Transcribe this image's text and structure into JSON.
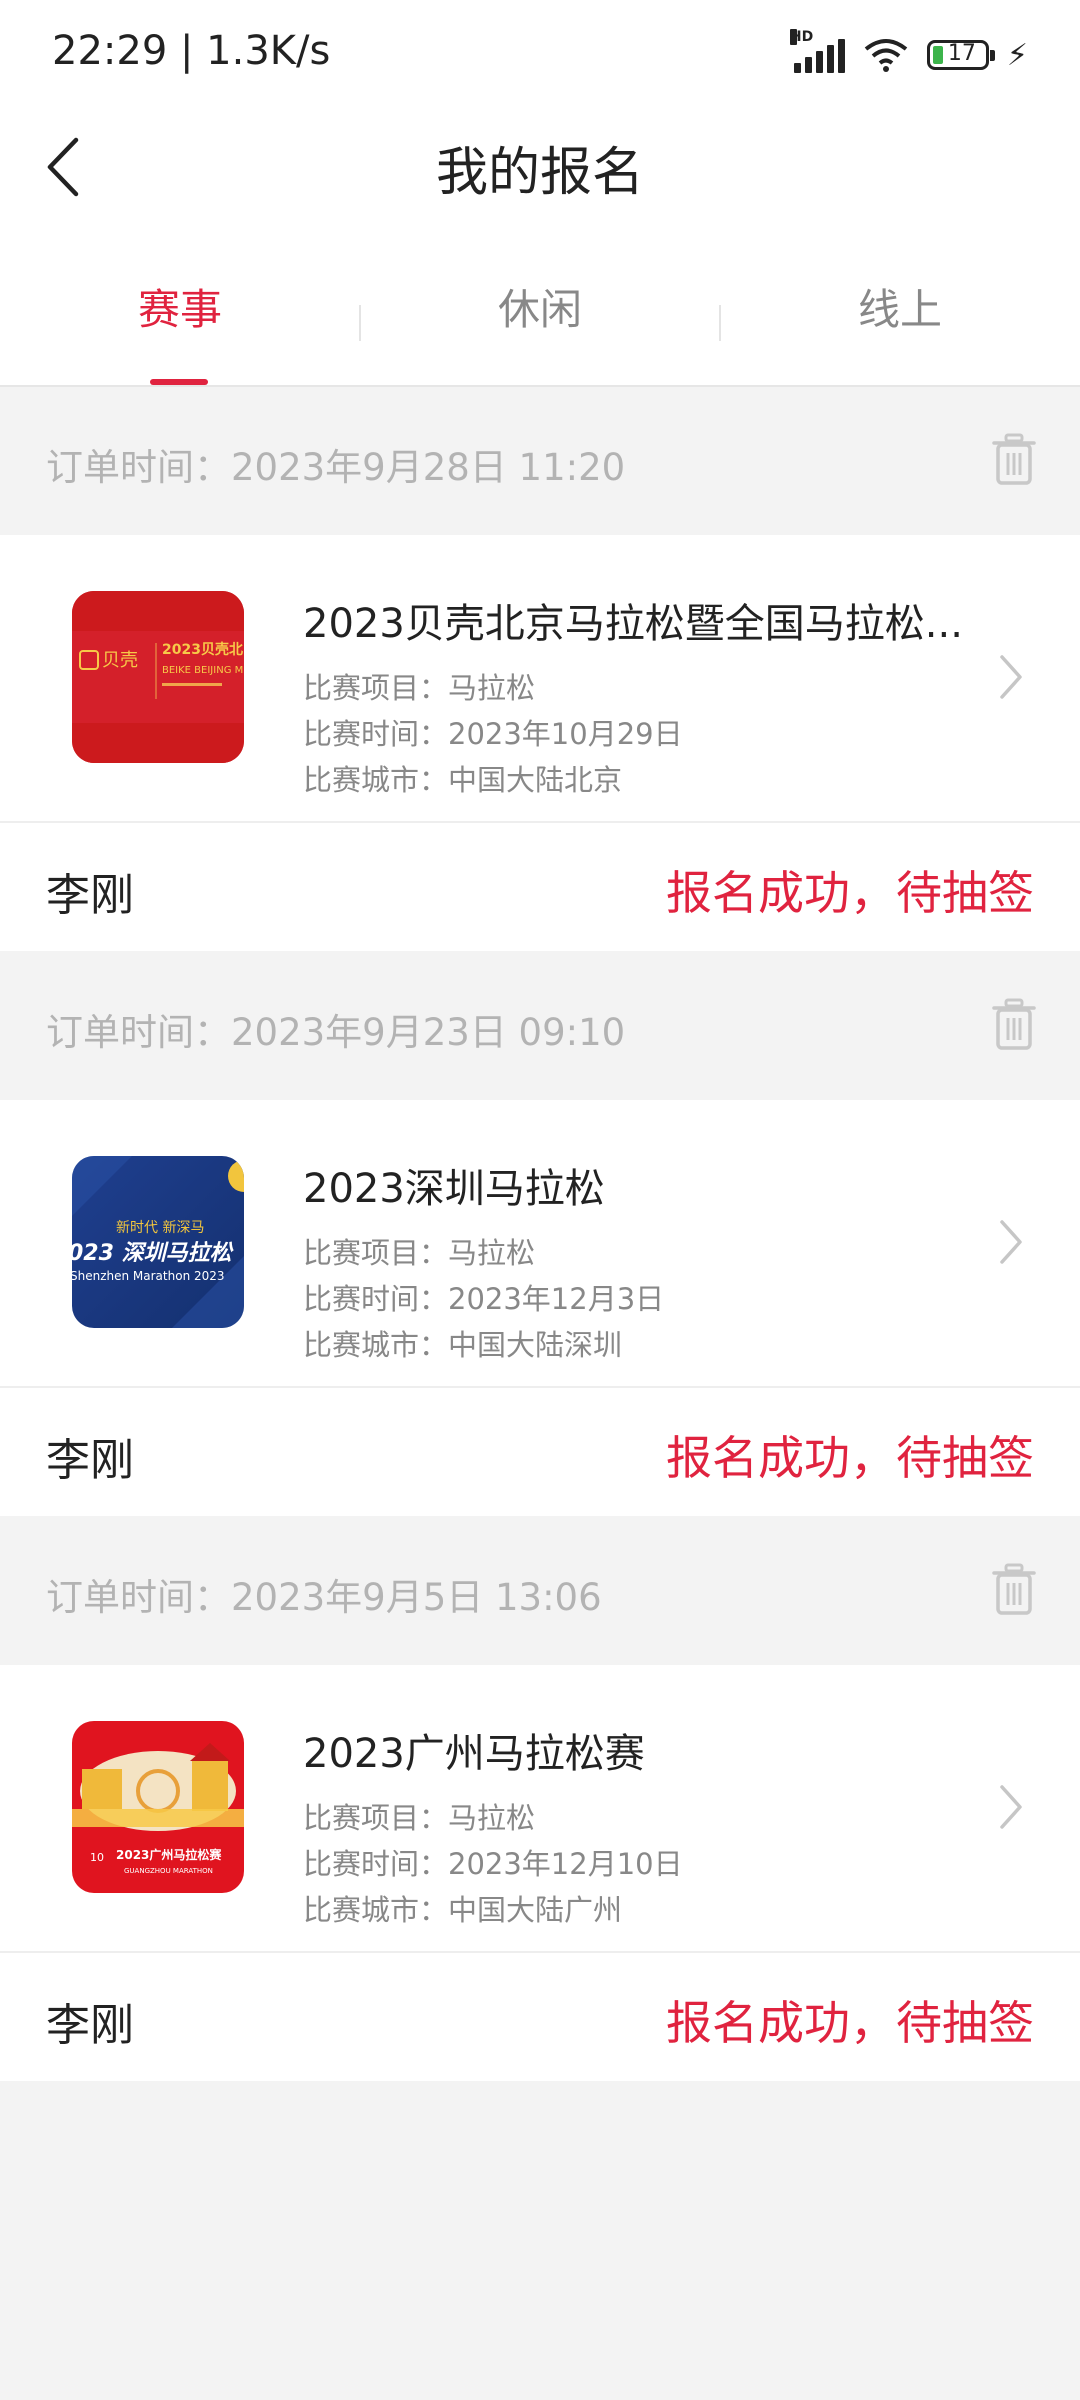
{
  "status_bar": {
    "time": "22:29 | 1.3K/s",
    "network_label": "HD",
    "battery_level": "17"
  },
  "header": {
    "title": "我的报名",
    "back_icon": "chevron-left-icon"
  },
  "tabs": [
    {
      "label": "赛事",
      "active": true
    },
    {
      "label": "休闲",
      "active": false
    },
    {
      "label": "线上",
      "active": false
    }
  ],
  "orders": [
    {
      "order_time": "订单时间：2023年9月28日 11:20",
      "race_name": "2023贝壳北京马拉松暨全国马拉松...",
      "event_line": "比赛项目：马拉松",
      "date_line": "比赛时间：2023年10月29日",
      "city_line": "比赛城市：中国大陆北京",
      "thumb_text": "2023贝壳北",
      "thumb_sub": "BEIKE BEIJING M",
      "thumb_logo": "贝壳",
      "participant": "李刚",
      "status": "报名成功，待抽签"
    },
    {
      "order_time": "订单时间：2023年9月23日 09:10",
      "race_name": "2023深圳马拉松",
      "event_line": "比赛项目：马拉松",
      "date_line": "比赛时间：2023年12月3日",
      "city_line": "比赛城市：中国大陆深圳",
      "thumb_text": "023 深圳马拉松",
      "thumb_sub": "Shenzhen Marathon 2023",
      "thumb_logo": "新时代 新深马",
      "participant": "李刚",
      "status": "报名成功，待抽签"
    },
    {
      "order_time": "订单时间：2023年9月5日 13:06",
      "race_name": "2023广州马拉松赛",
      "event_line": "比赛项目：马拉松",
      "date_line": "比赛时间：2023年12月10日",
      "city_line": "比赛城市：中国大陆广州",
      "thumb_text": "2023广州马拉松赛",
      "thumb_sub": "GUANGZHOU MARATHON",
      "thumb_logo": "10",
      "participant": "李刚",
      "status": "报名成功，待抽签"
    }
  ],
  "colors": {
    "accent": "#e0233f",
    "background": "#f3f3f3",
    "muted_text": "#888888"
  }
}
